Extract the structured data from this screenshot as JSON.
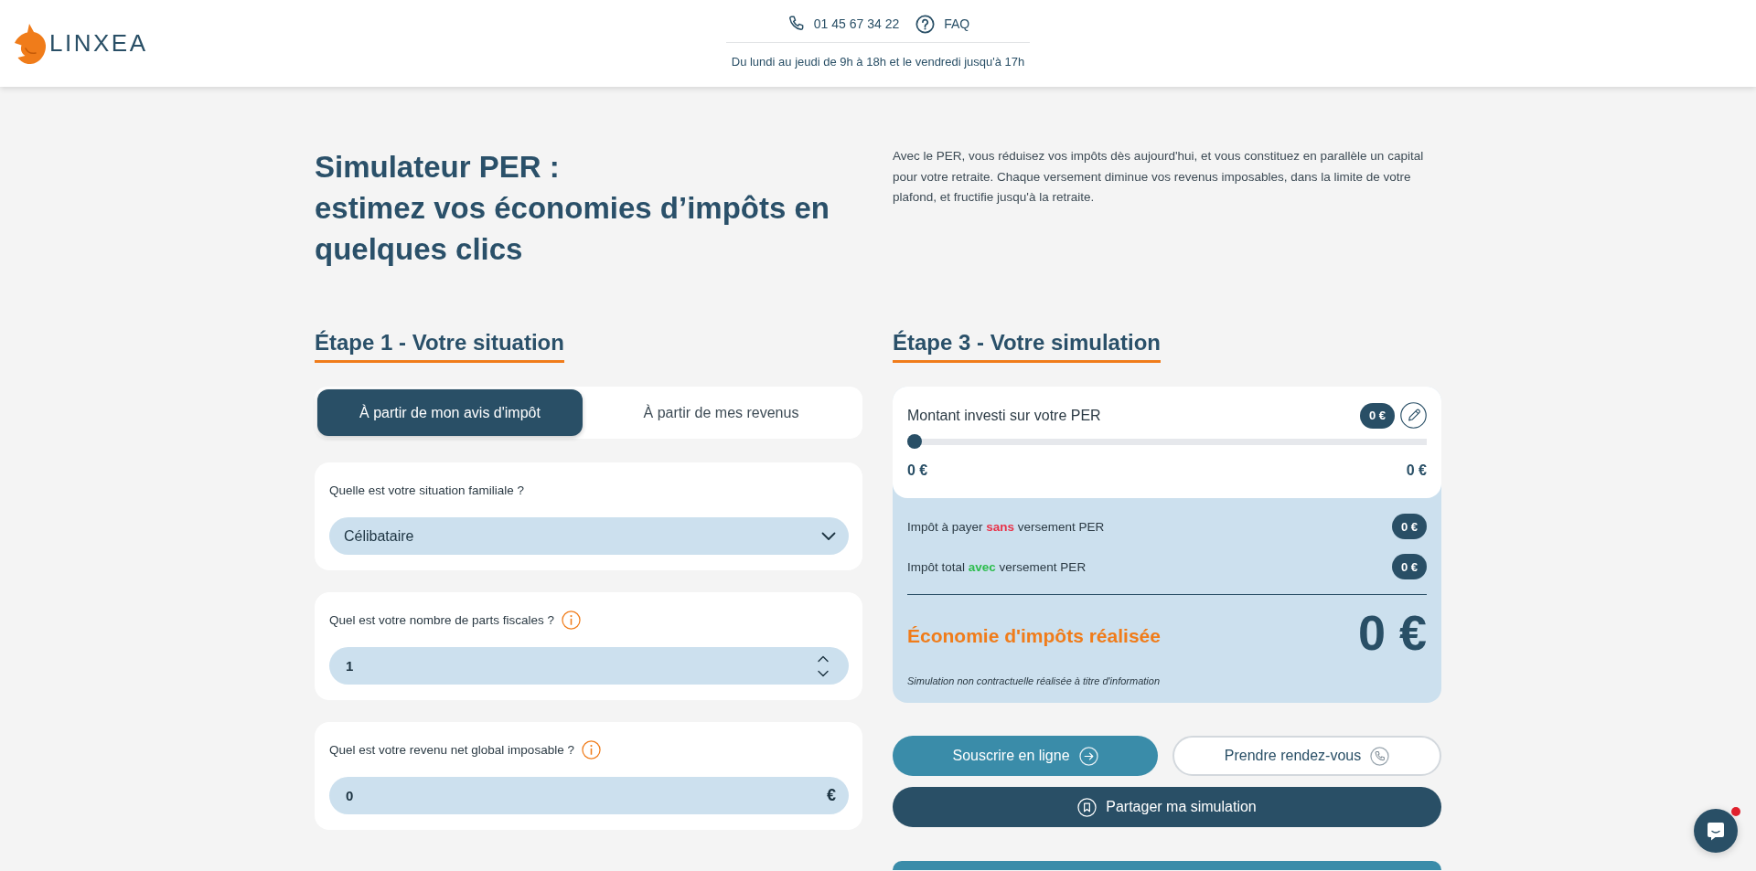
{
  "header": {
    "logo": "LINXEA",
    "phone": "01 45 67 34 22",
    "faq": "FAQ",
    "hours": "Du lundi au jeudi de 9h à 18h et le vendredi jusqu'à 17h"
  },
  "intro": {
    "title": "Simulateur PER :",
    "subtitle": "estimez vos économies d’impôts en quelques clics",
    "description": "Avec le PER, vous réduisez vos impôts dès aujourd'hui, et vous constituez en parallèle un capital pour votre retraite. Chaque versement diminue vos revenus imposables, dans la limite de votre plafond, et fructifie jusqu'à la retraite."
  },
  "step1": {
    "heading": "Étape 1 - Votre situation",
    "modes": [
      {
        "label": "À partir de mon avis d'impôt",
        "selected": true
      },
      {
        "label": "À partir de mes revenus",
        "selected": false
      }
    ],
    "questions": [
      {
        "kind": "select",
        "label": "Quelle est votre situation familiale ?",
        "info": false,
        "value": "Célibataire"
      },
      {
        "kind": "number",
        "label": "Quel est votre nombre de parts fiscales ?",
        "info": true,
        "value": "1"
      },
      {
        "kind": "amount",
        "label": "Quel est votre revenu net global imposable ?",
        "info": true,
        "value": "0",
        "unit": "€"
      }
    ]
  },
  "step3": {
    "heading": "Étape 3 - Votre simulation",
    "investment": {
      "label": "Montant investi sur votre PER",
      "badge": "0 €",
      "level": 0,
      "min": "0 €",
      "max": "0 €"
    },
    "results": [
      {
        "label": "Impôt à payer **sans** versement PER",
        "color": "#e8334a",
        "value": "0 €"
      },
      {
        "label": "Impôt total **avec** versement PER",
        "color": "#2dbd4e",
        "value": "0 €"
      }
    ],
    "savings": {
      "label": "Économie d'impôts réalisée",
      "value": "0 €"
    },
    "disclaimer": "Simulation non contractuelle réalisée à titre d'information",
    "actions": [
      {
        "kind": "primary",
        "label": "Souscrire en ligne"
      },
      {
        "kind": "outline",
        "label": "Prendre rendez-vous"
      },
      {
        "kind": "dark",
        "label": "Partager ma simulation"
      }
    ]
  },
  "chat": {
    "unread": true
  }
}
